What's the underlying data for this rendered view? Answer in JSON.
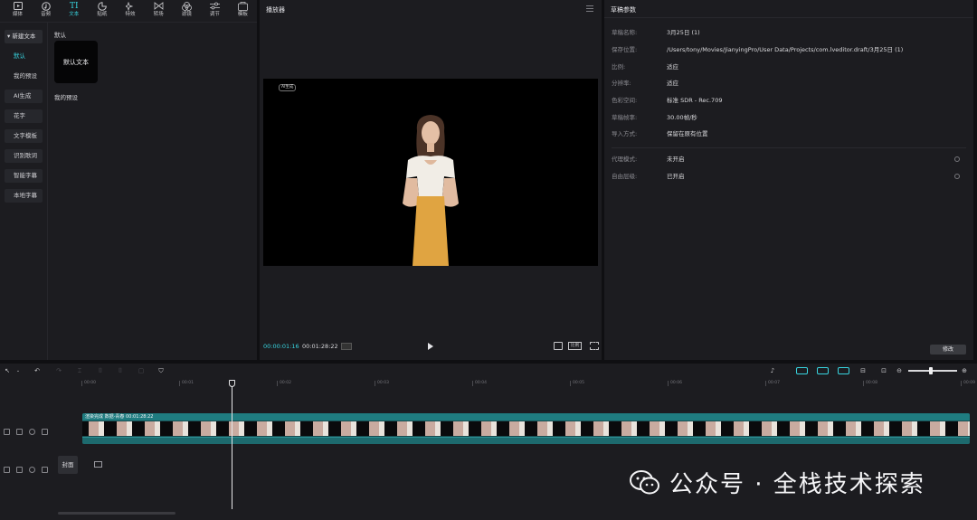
{
  "toolbar": {
    "tabs": [
      {
        "label": "媒体",
        "icon": "media-icon"
      },
      {
        "label": "音频",
        "icon": "audio-icon"
      },
      {
        "label": "文本",
        "icon": "text-icon",
        "active": true
      },
      {
        "label": "贴纸",
        "icon": "sticker-icon"
      },
      {
        "label": "特效",
        "icon": "effects-icon"
      },
      {
        "label": "转场",
        "icon": "transition-icon"
      },
      {
        "label": "滤镜",
        "icon": "filter-icon"
      },
      {
        "label": "调节",
        "icon": "adjust-icon"
      },
      {
        "label": "模板",
        "icon": "template-icon"
      }
    ]
  },
  "left_panel": {
    "categories": [
      "▾ 新建文本",
      "默认",
      "我的预设",
      "AI生成",
      "花字",
      "文字模板",
      "识别歌词",
      "智能字幕",
      "本地字幕"
    ],
    "section_default": "默认",
    "card_label": "默认文本",
    "section_preset": "我的预设"
  },
  "player": {
    "title": "播放器",
    "overlay_text": "AI生成",
    "time_current": "00:00:01:16",
    "time_total": "00:01:28:22",
    "ratio_label": "比例"
  },
  "params": {
    "title": "草稿参数",
    "rows": [
      {
        "key": "草稿名称:",
        "value": "3月25日 (1)"
      },
      {
        "key": "保存位置:",
        "value": "/Users/tony/Movies/JianyingPro/User Data/Projects/com.lveditor.draft/3月25日 (1)"
      },
      {
        "key": "比例:",
        "value": "适应"
      },
      {
        "key": "分辨率:",
        "value": "适应"
      },
      {
        "key": "色彩空间:",
        "value": "标准 SDR - Rec.709"
      },
      {
        "key": "草稿帧率:",
        "value": "30.00帧/秒"
      },
      {
        "key": "导入方式:",
        "value": "保留在原有位置"
      }
    ],
    "extra_rows": [
      {
        "key": "代理模式:",
        "value": "未开启"
      },
      {
        "key": "自由层级:",
        "value": "已开启"
      }
    ],
    "modify_label": "修改"
  },
  "timeline": {
    "ticks": [
      "00:00",
      "00:01",
      "00:02",
      "00:03",
      "00:04",
      "00:05",
      "00:06",
      "00:07",
      "00:08",
      "00:09"
    ],
    "clip_label": "渲染完成  数据-青春  00:01:28:22",
    "cover_label": "封面",
    "playhead_progress": 0.167
  },
  "watermark": {
    "text": "公众号 · 全栈技术探索"
  },
  "colors": {
    "accent": "#38d5e0",
    "panel": "#1c1c20",
    "clip": "#1f7c80"
  }
}
